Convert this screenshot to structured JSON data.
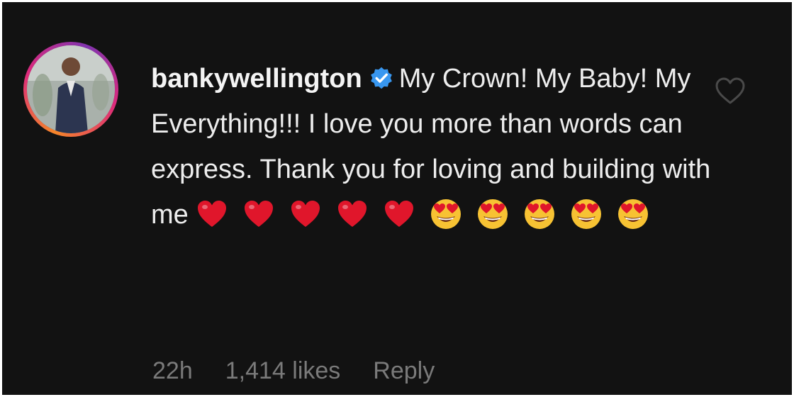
{
  "comment": {
    "username": "bankywellington",
    "text": "My Crown! My Baby! My Everything!!! I love you more than words can express. Thank you for loving and building with me",
    "emojis": [
      "red-heart-icon",
      "red-heart-icon",
      "red-heart-icon",
      "red-heart-icon",
      "red-heart-icon",
      "heart-eyes-emoji",
      "heart-eyes-emoji",
      "heart-eyes-emoji",
      "heart-eyes-emoji",
      "heart-eyes-emoji"
    ],
    "time": "22h",
    "likes": "1,414 likes",
    "reply_label": "Reply"
  },
  "colors": {
    "background": "#121212",
    "text": "#ededed",
    "meta": "#7a7a7a",
    "verified": "#3897f0",
    "heart": "#e0162b",
    "emoji_face": "#f7c233"
  }
}
